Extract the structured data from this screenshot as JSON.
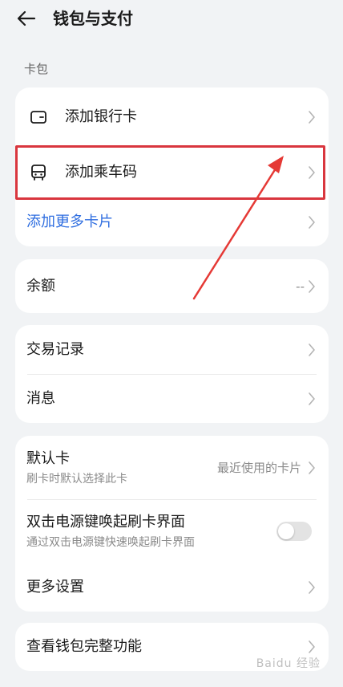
{
  "header": {
    "title": "钱包与支付"
  },
  "card_section": {
    "label": "卡包"
  },
  "cards": {
    "add_bank_card": "添加银行卡",
    "add_transit_code": "添加乘车码",
    "add_more_cards": "添加更多卡片"
  },
  "balance": {
    "label": "余额",
    "value": "--"
  },
  "records": {
    "transactions": "交易记录",
    "messages": "消息"
  },
  "settings": {
    "default_card": {
      "label": "默认卡",
      "sub": "刷卡时默认选择此卡",
      "value": "最近使用的卡片"
    },
    "double_click": {
      "label": "双击电源键唤起刷卡界面",
      "sub": "通过双击电源键快速唤起刷卡界面",
      "enabled": false
    },
    "more_settings": "更多设置"
  },
  "full_features": "查看钱包完整功能",
  "watermark": "Baidu 经验",
  "colors": {
    "accent": "#2f6ee0",
    "highlight": "#d9363e",
    "background": "#f1f3f5"
  }
}
